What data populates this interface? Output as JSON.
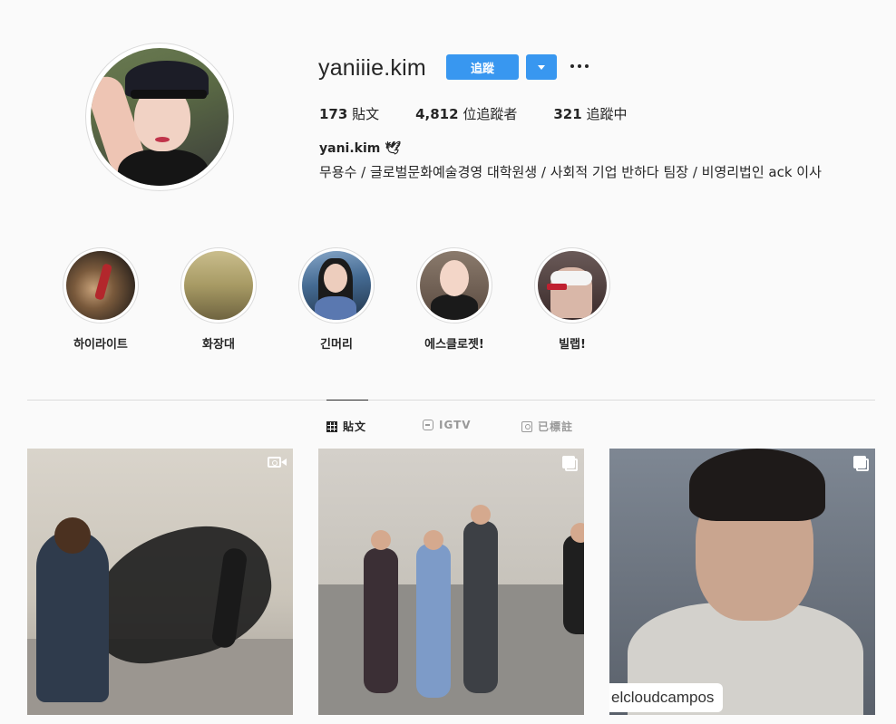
{
  "profile": {
    "username": "yaniiie.kim",
    "follow_label": "追蹤",
    "posts_count": "173",
    "posts_label": "貼文",
    "followers_count": "4,812",
    "followers_label": "位追蹤者",
    "following_count": "321",
    "following_label": "追蹤中",
    "full_name": "yani.kim 🕊",
    "bio": "무용수 / 글로벌문화예술경영 대학원생 / 사회적 기업 반하다 팀장 / 비영리법인 ack 이사"
  },
  "highlights": [
    {
      "label": "하이라이트"
    },
    {
      "label": "화장대"
    },
    {
      "label": "긴머리"
    },
    {
      "label": "에스클로젯!"
    },
    {
      "label": "빌랩!"
    }
  ],
  "tabs": [
    {
      "label": "貼文",
      "icon": "grid-icon",
      "active": true
    },
    {
      "label": "IGTV",
      "icon": "igtv-icon",
      "active": false
    },
    {
      "label": "已標註",
      "icon": "tagged-icon",
      "active": false
    }
  ],
  "posts": [
    {
      "badge": "video-icon"
    },
    {
      "badge": "carousel-icon"
    },
    {
      "badge": "carousel-icon",
      "watermark": "elcloudcampos"
    }
  ],
  "colors": {
    "accent": "#3897f0",
    "background": "#fafafa",
    "text": "#262626",
    "muted": "#999999"
  }
}
